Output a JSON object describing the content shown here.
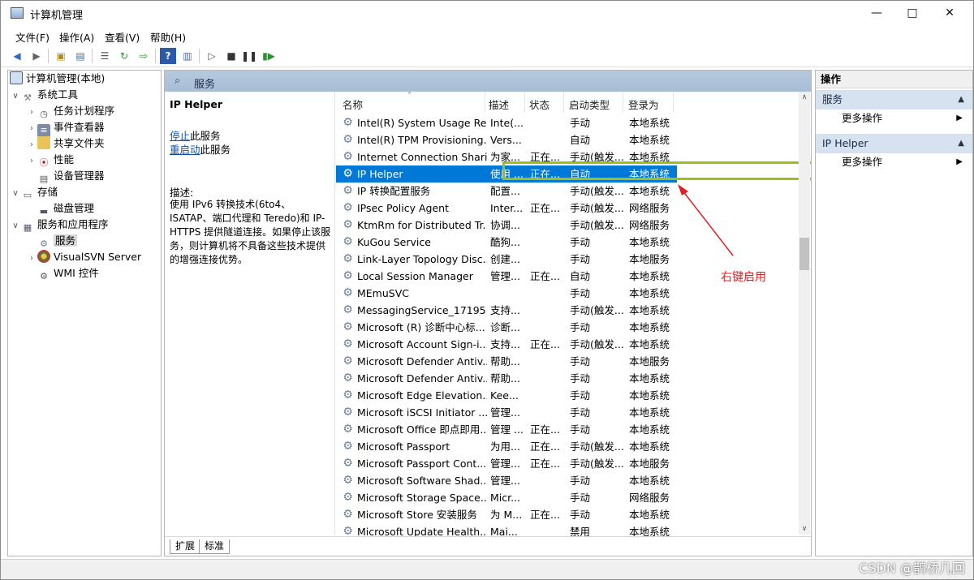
{
  "window": {
    "title": "计算机管理"
  },
  "menubar": [
    "文件(F)",
    "操作(A)",
    "查看(V)",
    "帮助(H)"
  ],
  "tree": [
    {
      "label": "计算机管理(本地)",
      "icon": "computer-management-icon"
    },
    {
      "label": "系统工具",
      "icon": "tools-icon"
    },
    {
      "label": "任务计划程序",
      "icon": "clock-icon"
    },
    {
      "label": "事件查看器",
      "icon": "event-viewer-icon"
    },
    {
      "label": "共享文件夹",
      "icon": "shared-folder-icon"
    },
    {
      "label": "性能",
      "icon": "performance-icon"
    },
    {
      "label": "设备管理器",
      "icon": "device-manager-icon"
    },
    {
      "label": "存储",
      "icon": "storage-icon"
    },
    {
      "label": "磁盘管理",
      "icon": "disk-icon"
    },
    {
      "label": "服务和应用程序",
      "icon": "services-apps-icon"
    },
    {
      "label": "服务",
      "icon": "services-icon"
    },
    {
      "label": "VisualSVN Server",
      "icon": "svn-icon"
    },
    {
      "label": "WMI 控件",
      "icon": "wmi-icon"
    }
  ],
  "center": {
    "header_title": "服务",
    "service_name": "IP Helper",
    "stop_link": "停止",
    "stop_suffix": "此服务",
    "restart_link": "重启动",
    "restart_suffix": "此服务",
    "desc_label": "描述:",
    "desc_text": "使用 IPv6 转换技术(6to4、ISATAP、端口代理和 Teredo)和 IP-HTTPS 提供隧道连接。如果停止该服务，则计算机将不具备这些技术提供的增强连接优势。",
    "columns": [
      "名称",
      "描述",
      "状态",
      "启动类型",
      "登录为"
    ],
    "rows": [
      {
        "name": "Intel(R) System Usage Re...",
        "desc": "Inte(...",
        "status": "",
        "startup": "手动",
        "logon": "本地系统"
      },
      {
        "name": "Intel(R) TPM Provisioning...",
        "desc": "Vers...",
        "status": "",
        "startup": "自动",
        "logon": "本地系统"
      },
      {
        "name": "Internet Connection Shari...",
        "desc": "为家...",
        "status": "正在...",
        "startup": "手动(触发...",
        "logon": "本地系统"
      },
      {
        "name": "IP Helper",
        "desc": "使用 ...",
        "status": "正在...",
        "startup": "自动",
        "logon": "本地系统"
      },
      {
        "name": "IP 转换配置服务",
        "desc": "配置...",
        "status": "",
        "startup": "手动(触发...",
        "logon": "本地系统"
      },
      {
        "name": "IPsec Policy Agent",
        "desc": "Inter...",
        "status": "正在...",
        "startup": "手动(触发...",
        "logon": "网络服务"
      },
      {
        "name": "KtmRm for Distributed Tr...",
        "desc": "协调...",
        "status": "",
        "startup": "手动(触发...",
        "logon": "网络服务"
      },
      {
        "name": "KuGou Service",
        "desc": "酷狗...",
        "status": "",
        "startup": "手动",
        "logon": "本地系统"
      },
      {
        "name": "Link-Layer Topology Disc...",
        "desc": "创建...",
        "status": "",
        "startup": "手动",
        "logon": "本地服务"
      },
      {
        "name": "Local Session Manager",
        "desc": "管理...",
        "status": "正在...",
        "startup": "自动",
        "logon": "本地系统"
      },
      {
        "name": "MEmuSVC",
        "desc": "",
        "status": "",
        "startup": "手动",
        "logon": "本地系统"
      },
      {
        "name": "MessagingService_17195...",
        "desc": "支持...",
        "status": "",
        "startup": "手动(触发...",
        "logon": "本地系统"
      },
      {
        "name": "Microsoft (R) 诊断中心标...",
        "desc": "诊断...",
        "status": "",
        "startup": "手动",
        "logon": "本地系统"
      },
      {
        "name": "Microsoft Account Sign-i...",
        "desc": "支持...",
        "status": "正在...",
        "startup": "手动(触发...",
        "logon": "本地系统"
      },
      {
        "name": "Microsoft Defender Antiv...",
        "desc": "帮助...",
        "status": "",
        "startup": "手动",
        "logon": "本地服务"
      },
      {
        "name": "Microsoft Defender Antiv...",
        "desc": "帮助...",
        "status": "",
        "startup": "手动",
        "logon": "本地系统"
      },
      {
        "name": "Microsoft Edge Elevation...",
        "desc": "Kee...",
        "status": "",
        "startup": "手动",
        "logon": "本地系统"
      },
      {
        "name": "Microsoft iSCSI Initiator ...",
        "desc": "管理...",
        "status": "",
        "startup": "手动",
        "logon": "本地系统"
      },
      {
        "name": "Microsoft Office 即点即用...",
        "desc": "管理 ...",
        "status": "正在...",
        "startup": "手动",
        "logon": "本地系统"
      },
      {
        "name": "Microsoft Passport",
        "desc": "为用...",
        "status": "正在...",
        "startup": "手动(触发...",
        "logon": "本地系统"
      },
      {
        "name": "Microsoft Passport Cont...",
        "desc": "管理...",
        "status": "正在...",
        "startup": "手动(触发...",
        "logon": "本地服务"
      },
      {
        "name": "Microsoft Software Shad...",
        "desc": "管理...",
        "status": "",
        "startup": "手动",
        "logon": "本地系统"
      },
      {
        "name": "Microsoft Storage Space...",
        "desc": "Micr...",
        "status": "",
        "startup": "手动",
        "logon": "网络服务"
      },
      {
        "name": "Microsoft Store 安装服务",
        "desc": "为 M...",
        "status": "正在...",
        "startup": "手动",
        "logon": "本地系统"
      },
      {
        "name": "Microsoft Update Health...",
        "desc": "Mai...",
        "status": "",
        "startup": "禁用",
        "logon": "本地系统"
      }
    ],
    "annotation": "右键启用",
    "tabs": [
      "扩展",
      "标准"
    ]
  },
  "actions": {
    "header": "操作",
    "section1": "服务",
    "section1_more": "更多操作",
    "section2": "IP Helper",
    "section2_more": "更多操作"
  },
  "watermark": "CSDN @鹊桥几回",
  "colors": {
    "selection": "#0078d7",
    "highlight_box": "#9cbf1e",
    "annotation": "#e02020",
    "link": "#0b50a8"
  }
}
